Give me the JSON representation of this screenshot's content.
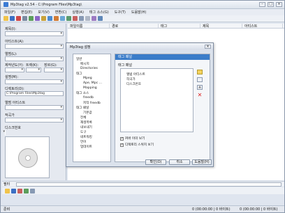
{
  "window": {
    "title": "Mp3tag v2.54 - C:\\Program Files\\Mp3tag\\"
  },
  "menu": [
    "파일(F)",
    "편집(E)",
    "보기(V)",
    "변환(C)",
    "실행(A)",
    "태그 소스(G)",
    "도구(T)",
    "도움말(H)"
  ],
  "tagpanel": {
    "title_label": "제목(I):",
    "artist_label": "아티스트(A):",
    "album_label": "앨범(L):",
    "year_label": "제작년도(Y):",
    "track_label": "트랙(K):",
    "genre_label": "장르(G):",
    "comment_label": "설명(M):",
    "directory_label": "디렉토리(D):",
    "directory_value": "C:\\Program Files\\Mp3tag",
    "album_artist_label": "앨범 아티스트",
    "composer_label": "작곡가",
    "disc_label": "디스크번호"
  },
  "list": {
    "columns": [
      "파일이름",
      "경로",
      "태그",
      "제목",
      "아티스트"
    ]
  },
  "filter_label": "필터",
  "status": {
    "left": "준비",
    "mid": "0 (00:00:00 | 0 바이트)",
    "right": "0 (00:00:00 | 0 바이트)"
  },
  "dialog": {
    "title": "Mp3tag 설정",
    "close": "×",
    "tree": [
      "일반",
      "메시지",
      "Directories",
      "태그",
      "Mpeg",
      "Ape, Mpc ...",
      "Mapping",
      "태그 소스",
      "freedb",
      "저작 freedb",
      "태그 패널",
      "기본값",
      "전체",
      "재생목록",
      "내보내기",
      "도구",
      "네트워킹",
      "언어",
      "업데이트"
    ],
    "panel_header": "태그 패널",
    "panel_title": "태그 패널",
    "tag_items": [
      "앨범 아티스트",
      "작곡가",
      "디스크번호"
    ],
    "checkboxes": [
      {
        "label": "커버 이미 보기",
        "checked": true
      },
      {
        "label": "디렉토리 스위치 보기",
        "checked": true
      }
    ],
    "buttons": {
      "ok": "확인(O)",
      "cancel": "취소",
      "help": "도움말(H)"
    }
  }
}
